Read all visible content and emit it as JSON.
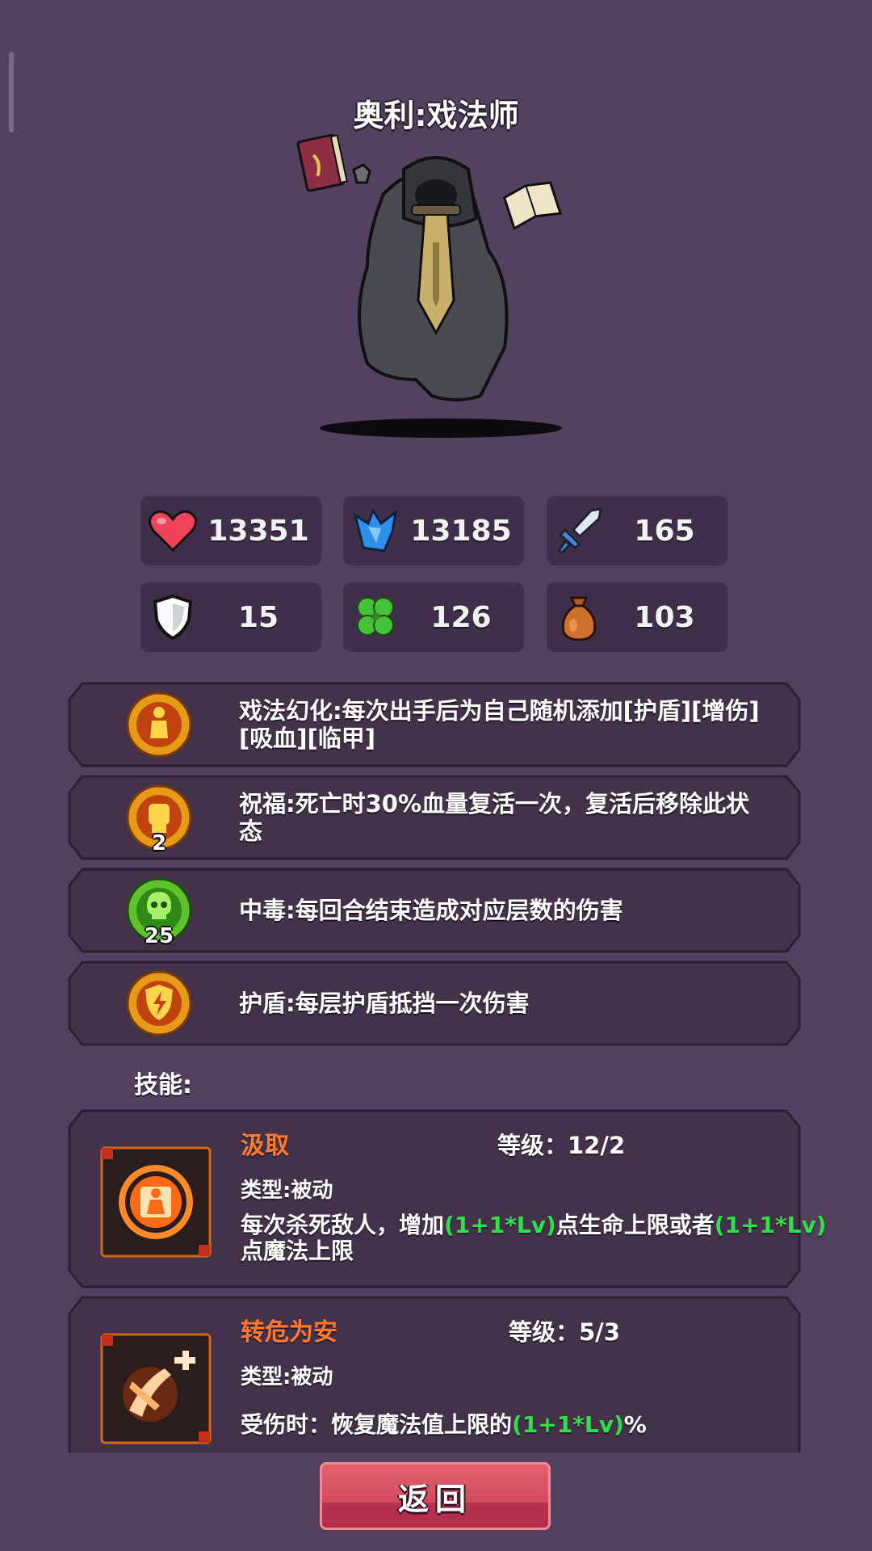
{
  "title": "奥利:戏法师",
  "stats": [
    {
      "icon": "heart-icon",
      "value": "13351"
    },
    {
      "icon": "mana-crystal-icon",
      "value": "13185"
    },
    {
      "icon": "sword-icon",
      "value": "165"
    },
    {
      "icon": "shield-icon",
      "value": "15"
    },
    {
      "icon": "clover-icon",
      "value": "126"
    },
    {
      "icon": "money-bag-icon",
      "value": "103"
    }
  ],
  "statuses": [
    {
      "icon": "illusion-icon",
      "badge": "",
      "text": "戏法幻化:每次出手后为自己随机添加[护盾][增伤][吸血][临甲]"
    },
    {
      "icon": "blessing-fist-icon",
      "badge": "2",
      "text": "祝福:死亡时30%血量复活一次，复活后移除此状态"
    },
    {
      "icon": "poison-skull-icon",
      "badge": "25",
      "text": "中毒:每回合结束造成对应层数的伤害"
    },
    {
      "icon": "shield-lightning-icon",
      "badge": "",
      "text": "护盾:每层护盾抵挡一次伤害"
    }
  ],
  "skills_label": "技能:",
  "skills": [
    {
      "name": "汲取",
      "level_label": "等级：12/2",
      "type": "类型:被动",
      "desc_parts": [
        "每次杀死敌人，增加",
        "(1+1*Lv)",
        "点生命上限或者",
        "(1+1*Lv)",
        "点魔法上限"
      ]
    },
    {
      "name": "转危为安",
      "level_label": "等级：5/3",
      "type": "类型:被动",
      "desc_parts": [
        "受伤时：恢复魔法值上限的",
        "(1+1*Lv)",
        "%"
      ]
    }
  ],
  "back_button": "返回",
  "colors": {
    "background": "#533f60",
    "panel": "#3f2f4a",
    "skill_name": "#ff7a2e",
    "formula": "#30e04a",
    "button": "#d24a5e"
  }
}
